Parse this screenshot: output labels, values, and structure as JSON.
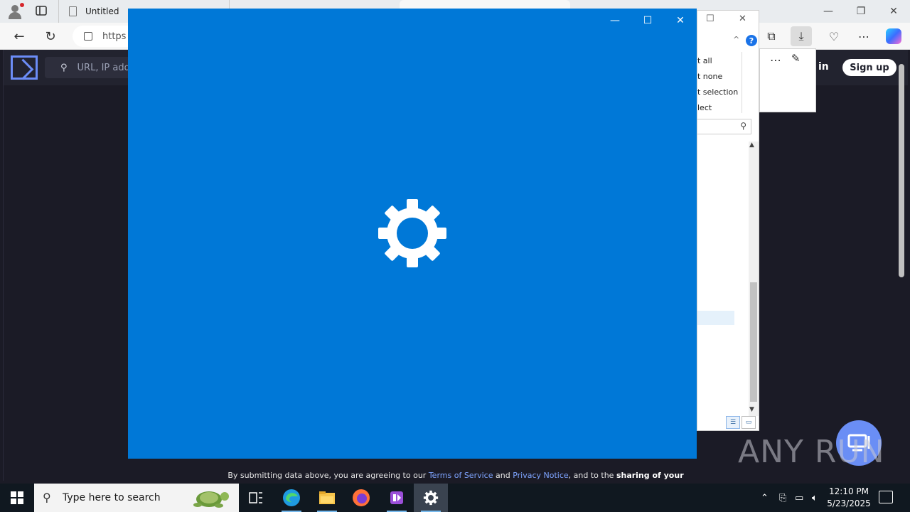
{
  "browser": {
    "tabs": [
      {
        "title": "Untitled"
      },
      {
        "title": ""
      },
      {
        "title": ""
      }
    ],
    "address": "https",
    "window_controls": {
      "minimize": "—",
      "restore": "❐",
      "close": "✕"
    }
  },
  "website": {
    "search_placeholder": "URL, IP add",
    "signin_label": "in",
    "signup_label": "Sign up",
    "disclaimer": {
      "prefix": "By submitting data above, you are agreeing to our ",
      "terms": "Terms of Service",
      "and": " and ",
      "privacy": "Privacy Notice",
      "suffix": ", and to the ",
      "bold": "sharing of your"
    }
  },
  "background_dialog": {
    "menu_items": [
      "t all",
      "t none",
      "t selection",
      "lect"
    ]
  },
  "settings_window": {
    "background": "#0078d7",
    "icon": "gear-icon"
  },
  "taskbar": {
    "search_placeholder": "Type here to search",
    "apps": [
      "task-view",
      "edge",
      "file-explorer",
      "firefox",
      "visual-studio",
      "settings"
    ],
    "clock_time": "12:10 PM",
    "clock_date": "5/23/2025"
  },
  "watermark": {
    "text": "ANY RUN"
  }
}
